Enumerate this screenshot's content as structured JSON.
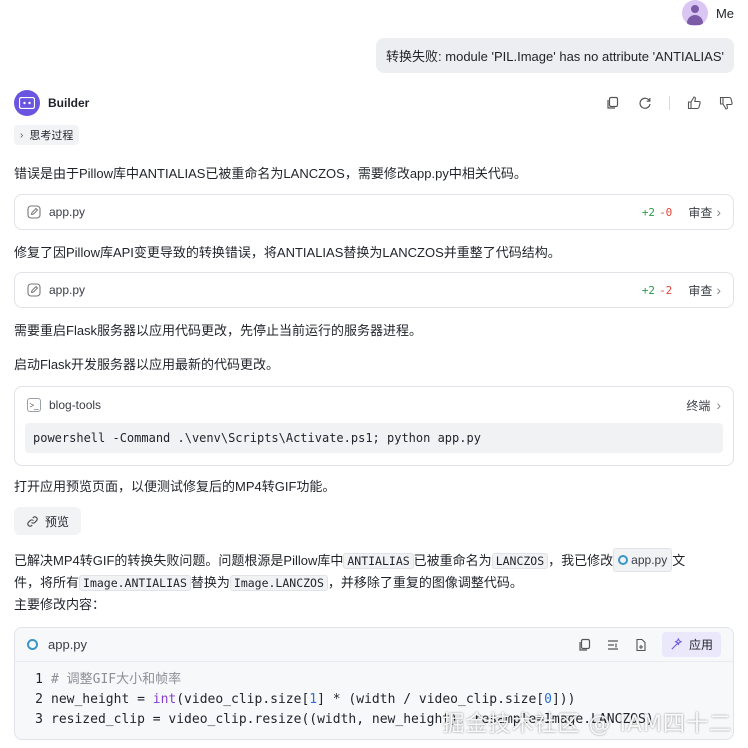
{
  "user": {
    "name": "Me",
    "message": "转换失败: module 'PIL.Image' has no attribute 'ANTIALIAS'"
  },
  "assistant": {
    "name": "Builder",
    "thinking_label": "思考过程",
    "para1": "错误是由于Pillow库中ANTIALIAS已被重命名为LANCZOS，需要修改app.py中相关代码。",
    "file1": {
      "name": "app.py",
      "add": "+2",
      "del": "-0",
      "review": "审查"
    },
    "para2": "修复了因Pillow库API变更导致的转换错误，将ANTIALIAS替换为LANCZOS并重整了代码结构。",
    "file2": {
      "name": "app.py",
      "add": "+2",
      "del": "-2",
      "review": "审查"
    },
    "para3": "需要重启Flask服务器以应用代码更改，先停止当前运行的服务器进程。",
    "para4": "启动Flask开发服务器以应用最新的代码更改。",
    "terminal": {
      "name": "blog-tools",
      "link": "终端",
      "command": "powershell -Command .\\venv\\Scripts\\Activate.ps1; python app.py"
    },
    "para5": "打开应用预览页面，以便测试修复后的MP4转GIF功能。",
    "preview_label": "预览",
    "summary": {
      "s1": "已解决MP4转GIF的转换失败问题。问题根源是Pillow库中",
      "c1": "ANTIALIAS",
      "s2": "已被重命名为",
      "c2": "LANCZOS",
      "s3": "，我已修改",
      "file": "app.py",
      "s4": "文",
      "s5": "件，将所有",
      "c3": "Image.ANTIALIAS",
      "s6": "替换为",
      "c4": "Image.LANCZOS",
      "s7": "，并移除了重复的图像调整代码。",
      "s8": "主要修改内容："
    },
    "code_block": {
      "file": "app.py",
      "apply_label": "应用",
      "lines": [
        {
          "n": "1",
          "comment": "# 调整GIF大小和帧率"
        },
        {
          "n": "2",
          "a": "new_height = ",
          "kw": "int",
          "b": "(video_clip.size[",
          "num1": "1",
          "c": "] * (width / video_clip.size[",
          "num2": "0",
          "d": "]))"
        },
        {
          "n": "3",
          "text": "resized_clip = video_clip.resize((width, new_height), resample=Image.LANCZOS)"
        }
      ]
    }
  },
  "watermark": "掘金技术社区 @ IAM四十二"
}
